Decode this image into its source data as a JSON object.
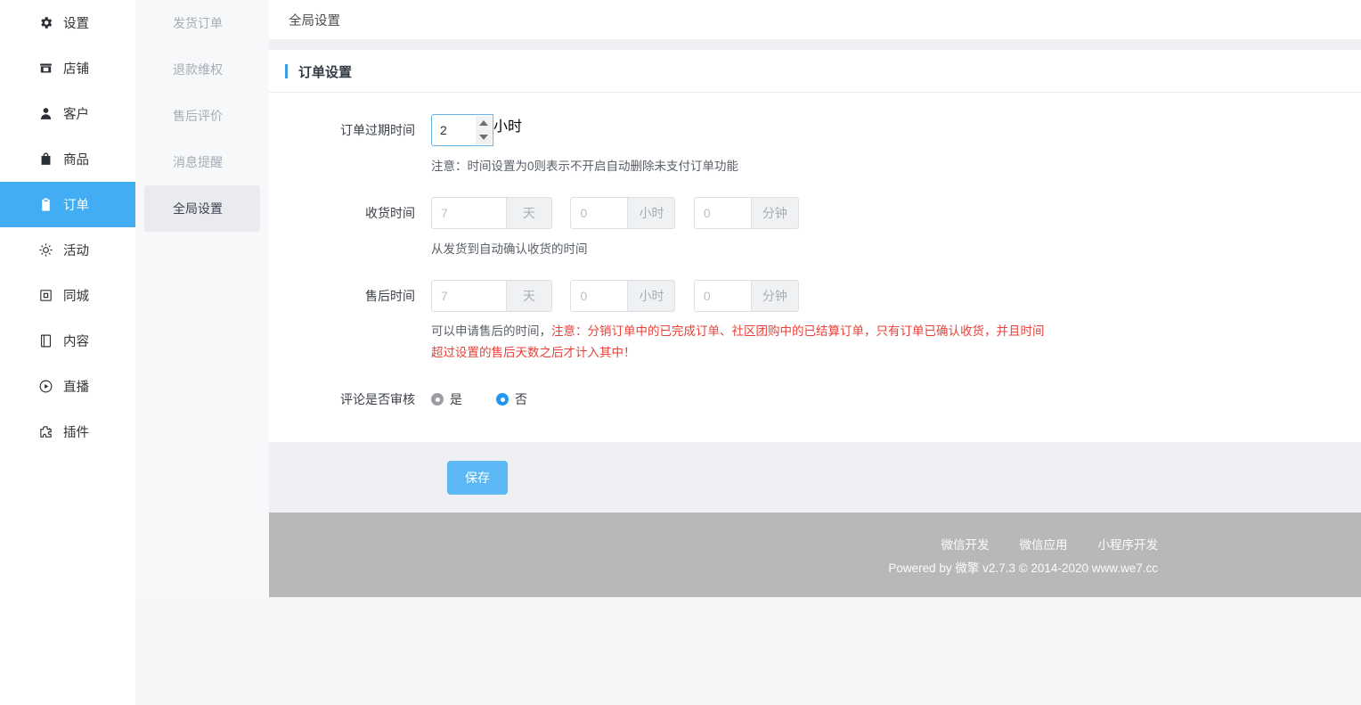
{
  "sidebar": {
    "items": [
      {
        "label": "设置",
        "icon": "gear-icon",
        "active": false
      },
      {
        "label": "店铺",
        "icon": "shop-icon",
        "active": false
      },
      {
        "label": "客户",
        "icon": "user-icon",
        "active": false
      },
      {
        "label": "商品",
        "icon": "bag-icon",
        "active": false
      },
      {
        "label": "订单",
        "icon": "clipboard-icon",
        "active": true
      },
      {
        "label": "活动",
        "icon": "sun-icon",
        "active": false
      },
      {
        "label": "同城",
        "icon": "city-icon",
        "active": false
      },
      {
        "label": "内容",
        "icon": "book-icon",
        "active": false
      },
      {
        "label": "直播",
        "icon": "play-circle-icon",
        "active": false
      },
      {
        "label": "插件",
        "icon": "puzzle-icon",
        "active": false
      }
    ]
  },
  "subnav": {
    "items": [
      {
        "label": "发货订单",
        "active": false
      },
      {
        "label": "退款维权",
        "active": false
      },
      {
        "label": "售后评价",
        "active": false
      },
      {
        "label": "消息提醒",
        "active": false
      },
      {
        "label": "全局设置",
        "active": true
      }
    ]
  },
  "topbar": {
    "title": "全局设置"
  },
  "card": {
    "title": "订单设置",
    "rows": {
      "expire": {
        "label": "订单过期时间",
        "value": "2",
        "unit": "小时",
        "hint": "注意：时间设置为0则表示不开启自动删除未支付订单功能"
      },
      "receive": {
        "label": "收货时间",
        "days_placeholder": "7",
        "days_unit": "天",
        "hours_placeholder": "0",
        "hours_unit": "小时",
        "minutes_placeholder": "0",
        "minutes_unit": "分钟",
        "hint": "从发货到自动确认收货的时间"
      },
      "aftersale": {
        "label": "售后时间",
        "days_placeholder": "7",
        "days_unit": "天",
        "hours_placeholder": "0",
        "hours_unit": "小时",
        "minutes_placeholder": "0",
        "minutes_unit": "分钟",
        "hint_normal": "可以申请售后的时间，",
        "hint_red": "注意：分销订单中的已完成订单、社区团购中的已结算订单，只有订单已确认收货，并且时间超过设置的售后天数之后才计入其中！"
      },
      "review": {
        "label": "评论是否审核",
        "option_yes": "是",
        "option_no": "否",
        "selected": "否"
      }
    }
  },
  "actions": {
    "save_label": "保存"
  },
  "footer": {
    "links": [
      "微信开发",
      "微信应用",
      "小程序开发"
    ],
    "copyright": "Powered by 微擎 v2.7.3 © 2014-2020 www.we7.cc"
  },
  "colors": {
    "accent": "#42adf2",
    "accent_bar": "#3c9ee5",
    "save_button": "#5bb8f5",
    "radio_on": "#2196f3",
    "warning_red": "#e8413a",
    "footer_bg": "#b7b8ba",
    "page_bg": "#f4f6f8"
  }
}
